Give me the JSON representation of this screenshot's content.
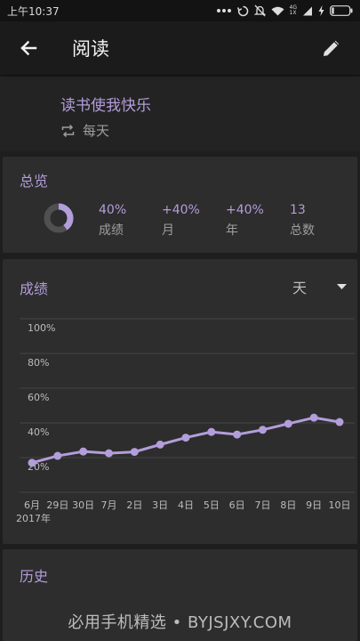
{
  "status_bar": {
    "time": "上午10:37",
    "network_label_top": "4G",
    "network_label_bottom": "1X"
  },
  "app_bar": {
    "title": "阅读"
  },
  "habit": {
    "name": "读书使我快乐",
    "frequency": "每天"
  },
  "overview": {
    "title": "总览",
    "ring_fraction": 0.4,
    "stats": [
      {
        "value": "40%",
        "label": "成绩"
      },
      {
        "value": "+40%",
        "label": "月"
      },
      {
        "value": "+40%",
        "label": "年"
      },
      {
        "value": "13",
        "label": "总数"
      }
    ]
  },
  "score": {
    "title": "成绩",
    "range_value": "天"
  },
  "chart_data": {
    "type": "line",
    "title": "",
    "xlabel": "",
    "ylabel": "",
    "y_ticks": [
      "100%",
      "80%",
      "60%",
      "40%",
      "20%"
    ],
    "ylim": [
      0,
      100
    ],
    "x_labels": [
      "6月",
      "29日",
      "30日",
      "7月",
      "2日",
      "3日",
      "4日",
      "5日",
      "6日",
      "7日",
      "8日",
      "9日",
      "10日"
    ],
    "year_label": "2017年",
    "grid": true,
    "series": [
      {
        "values": [
          17,
          21,
          23.5,
          22.5,
          23.3,
          27.5,
          31.5,
          34.8,
          33.3,
          36,
          39.5,
          43,
          40.5
        ]
      }
    ]
  },
  "history": {
    "title": "历史"
  },
  "watermark": "必用手机精选 • BYJSJXY.COM",
  "colors": {
    "accent": "#b39ddb",
    "background": "#1e1e1e",
    "card": "#2d2d2d"
  }
}
